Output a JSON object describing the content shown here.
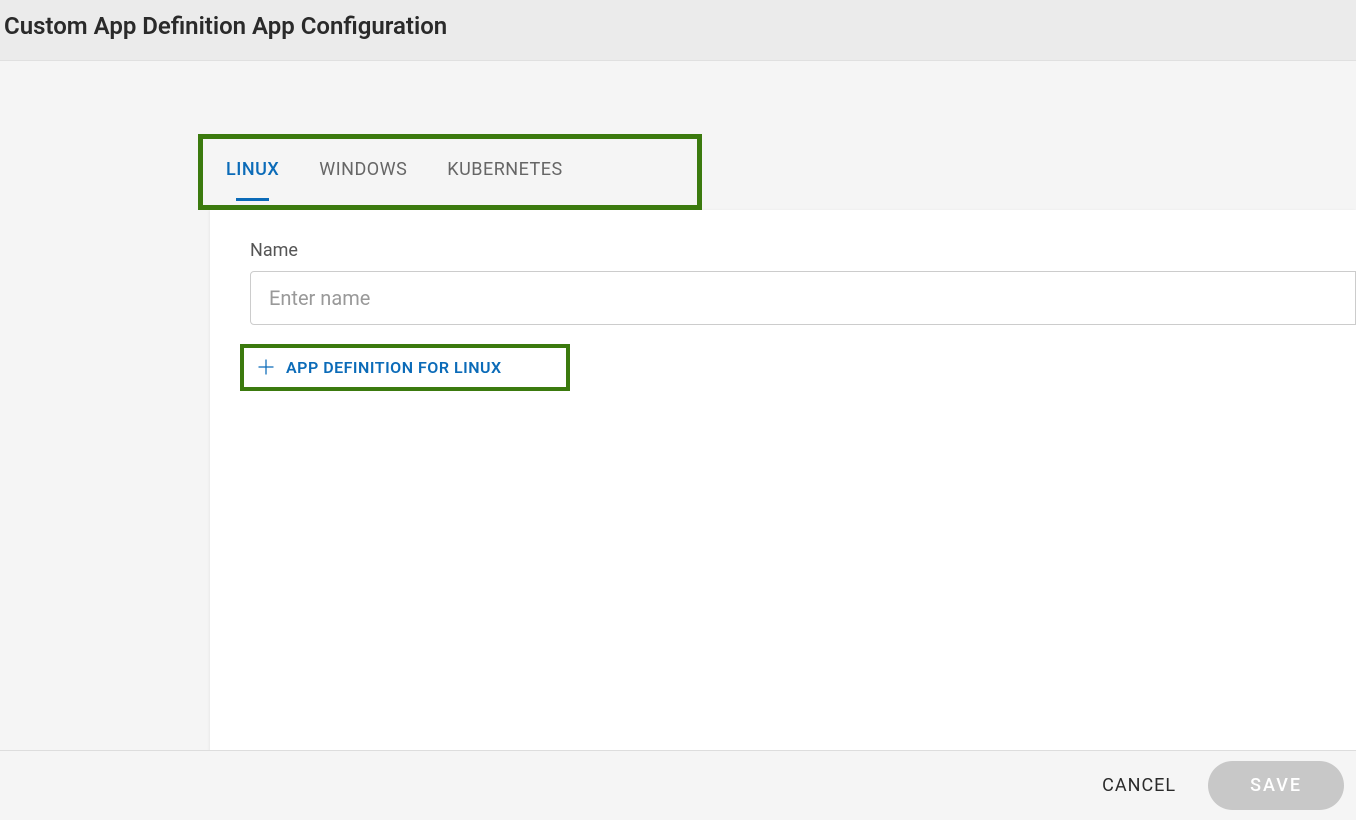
{
  "header": {
    "title": "Custom App Definition App Configuration"
  },
  "tabs": {
    "items": [
      {
        "label": "LINUX",
        "active": true
      },
      {
        "label": "WINDOWS",
        "active": false
      },
      {
        "label": "KUBERNETES",
        "active": false
      }
    ]
  },
  "form": {
    "nameLabel": "Name",
    "namePlaceholder": "Enter name",
    "nameValue": ""
  },
  "addButton": {
    "label": "APP DEFINITION FOR LINUX"
  },
  "footer": {
    "cancelLabel": "CANCEL",
    "saveLabel": "SAVE"
  }
}
